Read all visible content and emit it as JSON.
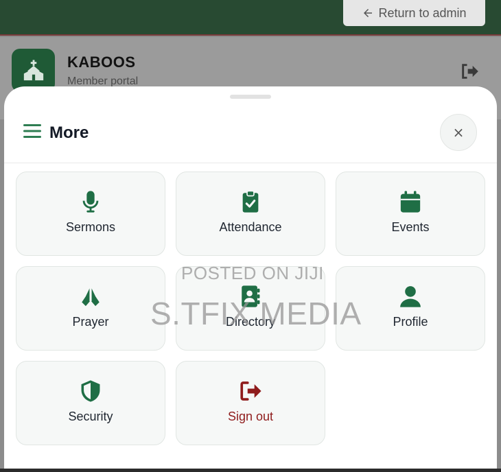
{
  "admin_bar": {
    "return_label": "Return to admin"
  },
  "header": {
    "app_name": "KABOOS",
    "subtitle": "Member portal"
  },
  "sheet": {
    "title": "More",
    "close_glyph": "×",
    "tiles": [
      {
        "label": "Sermons",
        "icon": "microphone-icon"
      },
      {
        "label": "Attendance",
        "icon": "clipboard-check-icon"
      },
      {
        "label": "Events",
        "icon": "calendar-icon"
      },
      {
        "label": "Prayer",
        "icon": "praying-hands-icon"
      },
      {
        "label": "Directory",
        "icon": "address-book-icon"
      },
      {
        "label": "Profile",
        "icon": "user-icon"
      },
      {
        "label": "Security",
        "icon": "shield-icon"
      },
      {
        "label": "Sign out",
        "icon": "sign-out-icon"
      }
    ]
  },
  "watermark": {
    "line1": "POSTED ON JIJI",
    "line2": "S.TFIX MEDIA"
  },
  "colors": {
    "brand": "#1f6e45",
    "danger": "#8f1c1c",
    "topbar": "#284a32"
  }
}
